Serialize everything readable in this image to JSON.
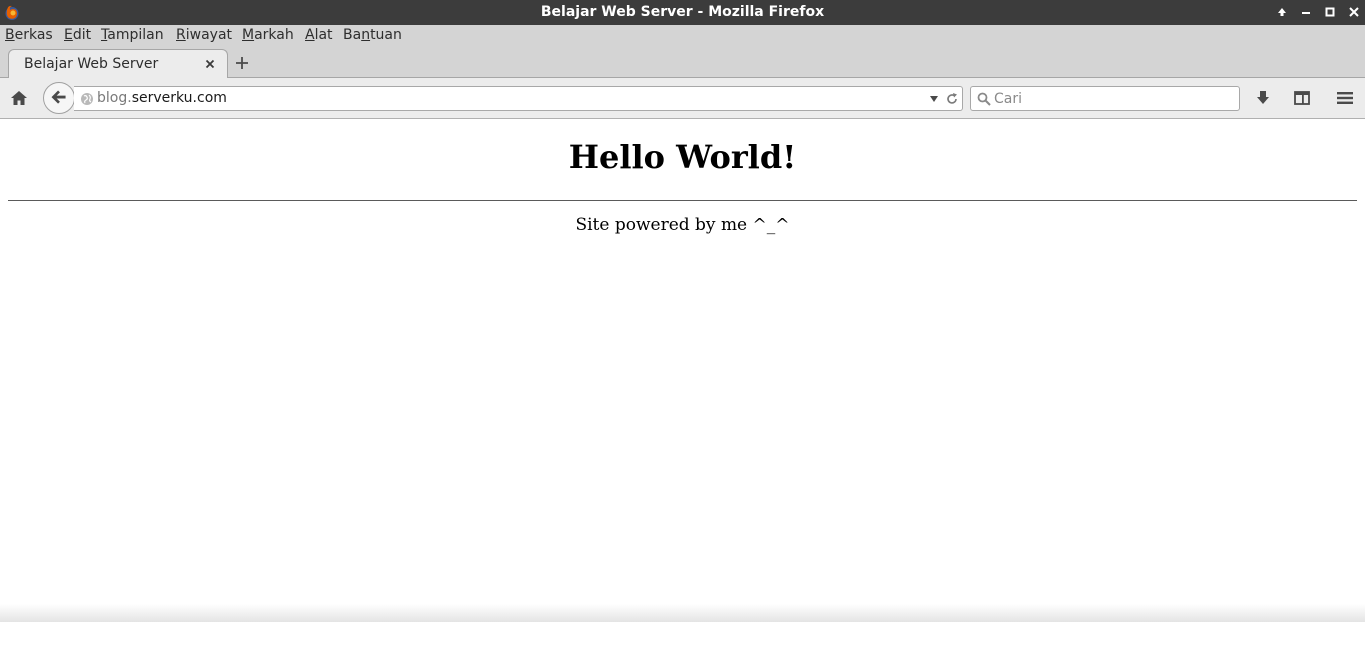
{
  "window": {
    "title": "Belajar Web Server - Mozilla Firefox"
  },
  "menubar": {
    "items": [
      {
        "pre": "",
        "key": "B",
        "post": "erkas"
      },
      {
        "pre": "",
        "key": "E",
        "post": "dit"
      },
      {
        "pre": "",
        "key": "T",
        "post": "ampilan"
      },
      {
        "pre": "",
        "key": "R",
        "post": "iwayat"
      },
      {
        "pre": "",
        "key": "M",
        "post": "arkah"
      },
      {
        "pre": "",
        "key": "A",
        "post": "lat"
      },
      {
        "pre": "Ba",
        "key": "n",
        "post": "tuan"
      }
    ]
  },
  "tabs": [
    {
      "label": "Belajar Web Server"
    }
  ],
  "navbar": {
    "url_prefix": "blog.",
    "url_domain": "serverku.com",
    "search_placeholder": "Cari"
  },
  "page": {
    "heading": "Hello World!",
    "footer": "Site powered by me ^_^"
  },
  "colors": {
    "titlebar": "#3c3c3c",
    "chrome": "#d4d4d4",
    "toolbar": "#ececec"
  },
  "icons": [
    "firefox-icon",
    "maximize-up-icon",
    "minimize-icon",
    "maximize-icon",
    "close-icon",
    "tab-close-icon",
    "new-tab-icon",
    "home-icon",
    "back-arrow-icon",
    "globe-icon",
    "dropdown-icon",
    "reload-icon",
    "search-icon",
    "download-icon",
    "sidebar-icon",
    "hamburger-menu-icon"
  ]
}
